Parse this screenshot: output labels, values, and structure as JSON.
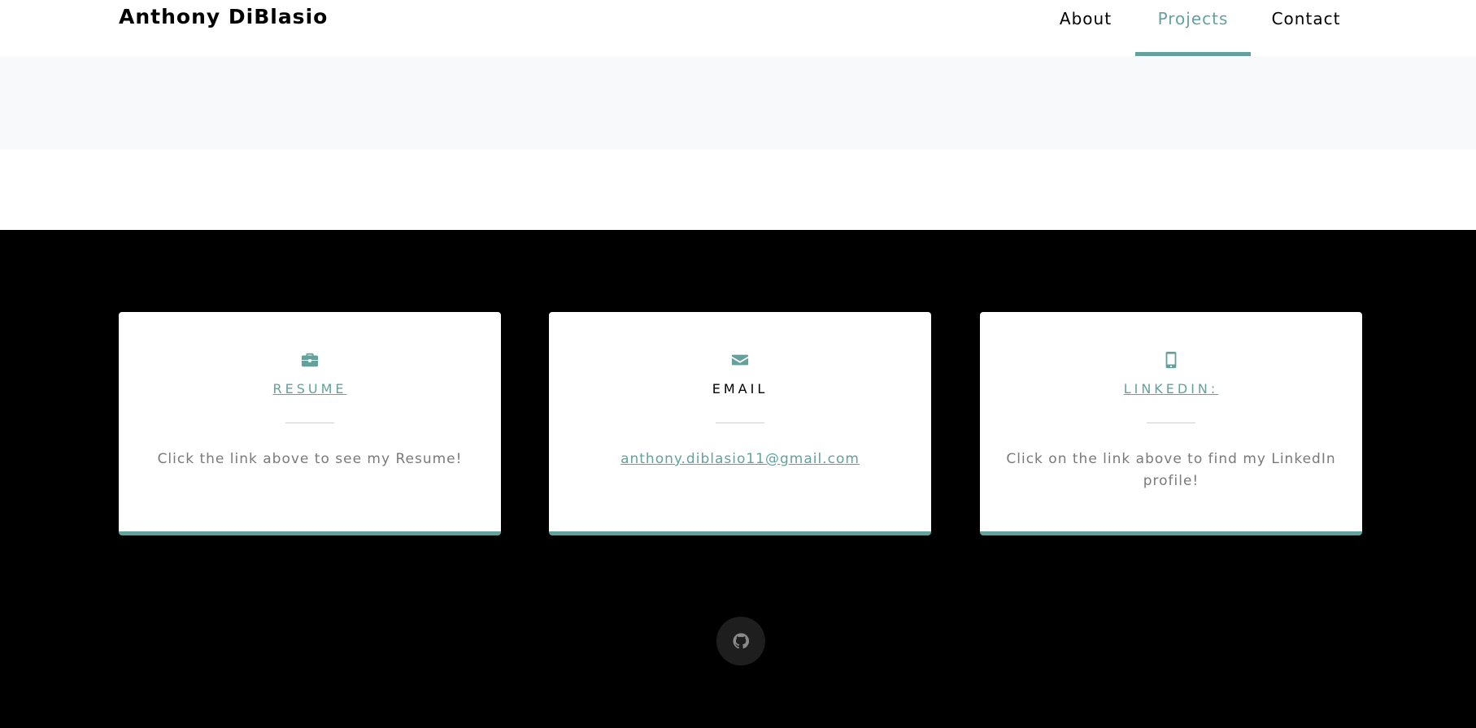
{
  "nav": {
    "brand": "Anthony DiBlasio",
    "items": [
      {
        "label": "About",
        "active": false
      },
      {
        "label": "Projects",
        "active": true
      },
      {
        "label": "Contact",
        "active": false
      }
    ]
  },
  "contact": {
    "cards": [
      {
        "icon": "briefcase-icon",
        "title": "Resume",
        "title_is_link": true,
        "text": "Click the link above to see my Resume!"
      },
      {
        "icon": "envelope-icon",
        "title": "Email",
        "title_is_link": false,
        "text": "anthony.diblasio11@gmail.com",
        "text_is_link": true
      },
      {
        "icon": "mobile-phone-icon",
        "title": "LinkedIn:",
        "title_is_link": true,
        "text": "Click on the link above to find my LinkedIn profile!"
      }
    ]
  },
  "social": {
    "icon": "github-icon"
  },
  "colors": {
    "accent": "#64a19d",
    "dark": "#000000",
    "light_band": "#f8f9fa"
  }
}
